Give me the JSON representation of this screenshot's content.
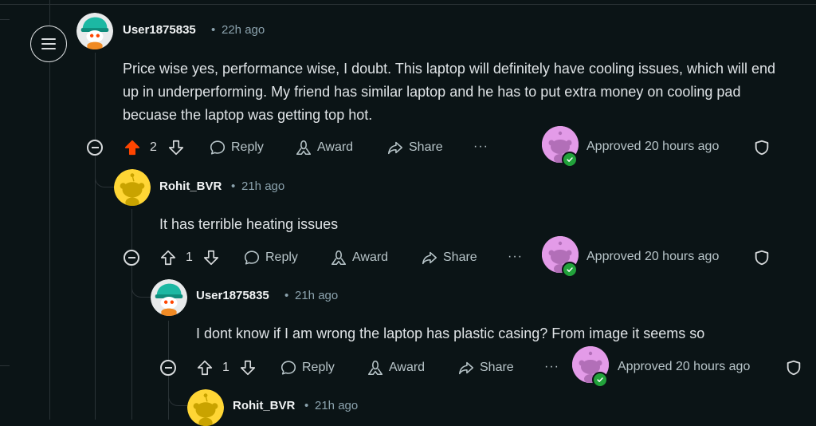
{
  "comments": [
    {
      "username": "User1875835",
      "time": "22h ago",
      "text": "Price wise yes, performance wise, I doubt. This laptop will definitely have cooling issues, which will end up in underperforming. My friend has similar laptop and he has to put extra money on cooling pad becuase the laptop was getting top hot.",
      "votes": "2",
      "upvoted": true,
      "approved": "Approved 20 hours ago"
    },
    {
      "username": "Rohit_BVR",
      "time": "21h ago",
      "text": "It has terrible heating issues",
      "votes": "1",
      "upvoted": false,
      "approved": "Approved 20 hours ago"
    },
    {
      "username": "User1875835",
      "time": "21h ago",
      "text": "I dont know if I am wrong the laptop has plastic casing? From image it seems so",
      "votes": "1",
      "upvoted": false,
      "approved": "Approved 20 hours ago"
    },
    {
      "username": "Rohit_BVR",
      "time": "21h ago"
    }
  ],
  "actions": {
    "reply": "Reply",
    "award": "Award",
    "share": "Share",
    "more": "···"
  },
  "separator": "•",
  "colors": {
    "background": "#0b1416",
    "upvote_active": "#ff4500",
    "approved_check": "#22a23b",
    "mod_avatar": "#e39be8"
  },
  "icons": [
    "menu-icon",
    "collapse-icon",
    "upvote-icon",
    "downvote-icon",
    "reply-icon",
    "award-icon",
    "share-icon",
    "shield-icon",
    "check-icon"
  ]
}
